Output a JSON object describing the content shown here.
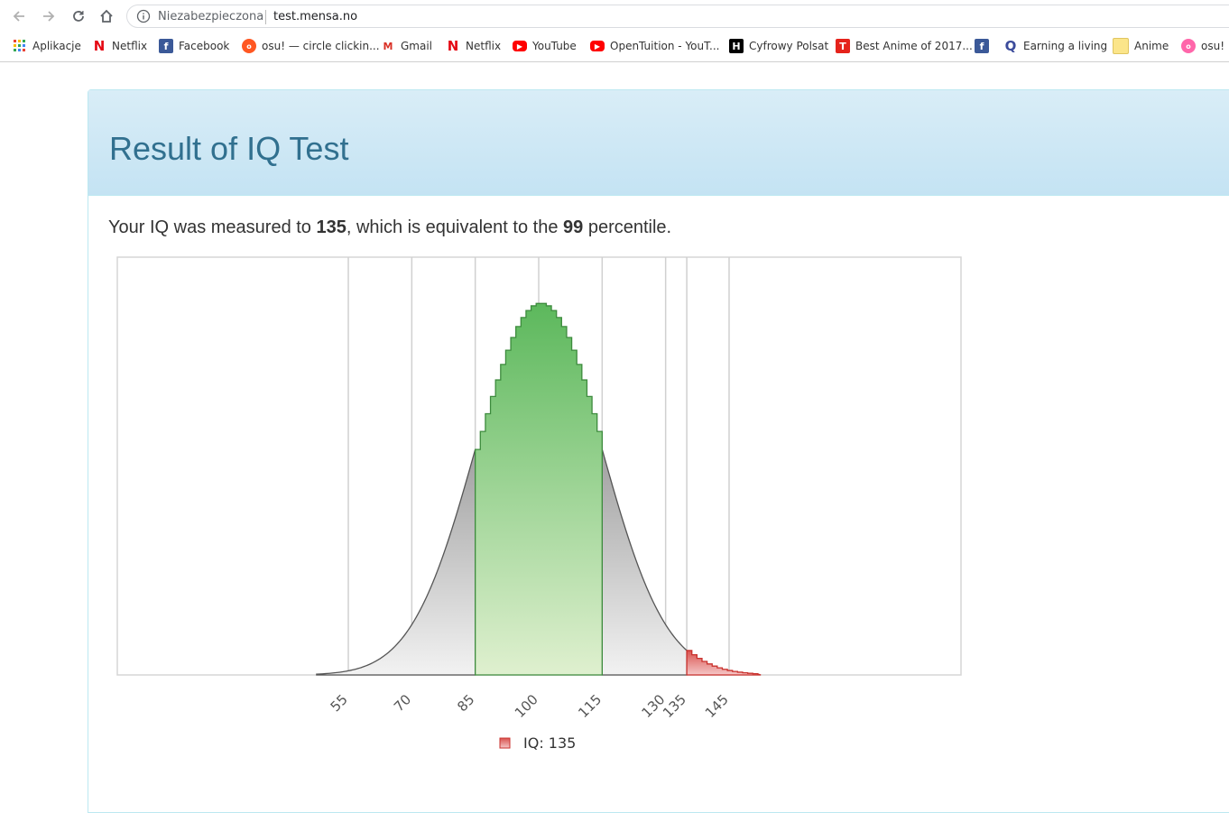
{
  "browser": {
    "security_label": "Niezabezpieczona",
    "url": "test.mensa.no"
  },
  "bookmarks": [
    {
      "label": "Aplikacje",
      "icon": "apps-grid-icon",
      "color": "#4285f4"
    },
    {
      "label": "Netflix",
      "icon": "netflix-icon",
      "color": "#e50914"
    },
    {
      "label": "Facebook",
      "icon": "facebook-icon",
      "color": "#3b5998"
    },
    {
      "label": "osu! — circle clickin...",
      "icon": "osu-icon",
      "color": "#ff5722"
    },
    {
      "label": "Gmail",
      "icon": "gmail-icon",
      "color": "#d93025"
    },
    {
      "label": "Netflix",
      "icon": "netflix-icon",
      "color": "#e50914"
    },
    {
      "label": "YouTube",
      "icon": "youtube-icon",
      "color": "#ff0000"
    },
    {
      "label": "OpenTuition - YouT...",
      "icon": "youtube-icon",
      "color": "#ff0000"
    },
    {
      "label": "Cyfrowy Polsat",
      "icon": "hbo-go-icon",
      "color": "#000000"
    },
    {
      "label": "Best Anime of 2017...",
      "icon": "t-icon",
      "color": "#e5231b"
    },
    {
      "label": "",
      "icon": "facebook-icon",
      "color": "#3b5998"
    },
    {
      "label": "Earning a living",
      "icon": "quora-icon",
      "color": "#3b4b9b"
    },
    {
      "label": "Anime",
      "icon": "folder-note-icon",
      "color": "#fbe58a"
    },
    {
      "label": "osu!",
      "icon": "osu-pink-icon",
      "color": "#ff66aa"
    }
  ],
  "page": {
    "title": "Result of IQ Test",
    "summary_prefix": "Your IQ was measured to ",
    "iq_value": "135",
    "summary_middle": ", which is equivalent to the ",
    "percentile_value": "99",
    "summary_suffix": " percentile."
  },
  "chart_data": {
    "type": "area",
    "distribution": "normal",
    "mean": 100,
    "sd": 15,
    "x_ticks": [
      55,
      70,
      85,
      100,
      115,
      130,
      135,
      145
    ],
    "xlim": [
      0,
      200
    ],
    "highlight_range": [
      85,
      115
    ],
    "marked_value": 135,
    "legend": "IQ: 135",
    "colors": {
      "tail_fill": "#d9d9d9",
      "middle_fill": "#5cb85c",
      "marker_fill": "#d9534f",
      "outline": "#555555"
    }
  }
}
